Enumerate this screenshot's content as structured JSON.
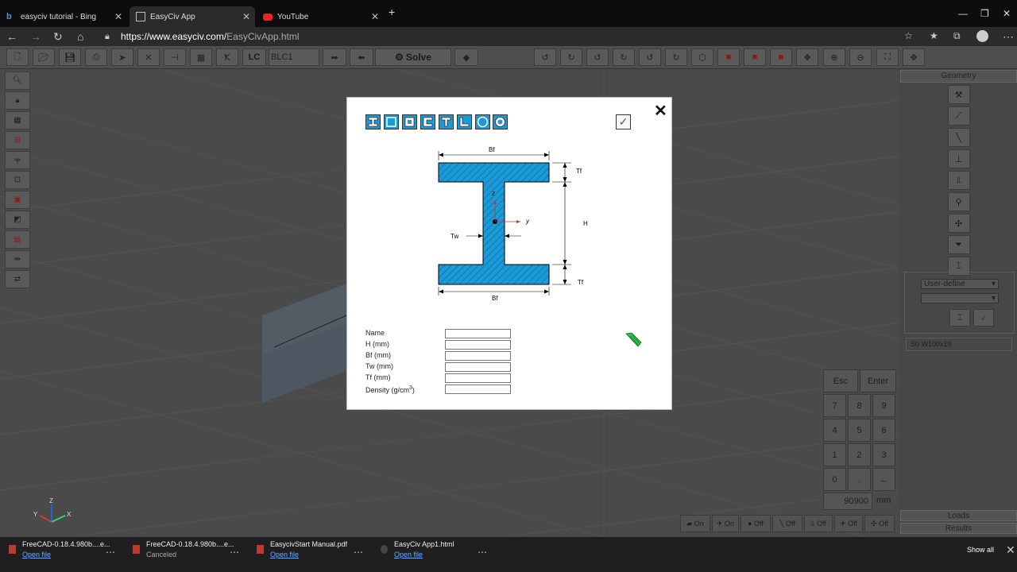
{
  "browser": {
    "tabs": [
      {
        "title": "easyciv tutorial - Bing",
        "active": false
      },
      {
        "title": "EasyCiv App",
        "active": true
      },
      {
        "title": "YouTube",
        "active": false
      }
    ],
    "new_tab": "+",
    "url_main": "https://www.easyciv.com/",
    "url_path": "EasyCivApp.html"
  },
  "toolbar": {
    "lc_label": "LC",
    "load_case": "BLC1",
    "solve_label": "Solve"
  },
  "right_panel": {
    "geometry_tab": "Geometry",
    "select_value": "User-define",
    "section_info": "S0  W100x19",
    "loads_tab": "Loads",
    "results_tab": "Results"
  },
  "numpad": {
    "esc": "Esc",
    "enter": "Enter",
    "keys": [
      "7",
      "8",
      "9",
      "4",
      "5",
      "6",
      "1",
      "2",
      "3",
      "0",
      ".",
      "←"
    ],
    "value": "90900",
    "unit": "mm"
  },
  "bottom_toggles": [
    "On",
    "On",
    "Off",
    "Off",
    "Off",
    "Off",
    "Off"
  ],
  "modal": {
    "close": "✕",
    "diagram": {
      "bf_top": "Bf",
      "bf_bottom": "Bf",
      "tf_top": "Tf",
      "tf_bottom": "Tf",
      "h": "H",
      "tw": "Tw",
      "axis_y": "y",
      "axis_z": "z"
    },
    "fields": [
      {
        "label": "Name",
        "value": ""
      },
      {
        "label": "H (mm)",
        "value": ""
      },
      {
        "label": "Bf (mm)",
        "value": ""
      },
      {
        "label": "Tw (mm)",
        "value": ""
      },
      {
        "label": "Tf (mm)",
        "value": ""
      }
    ],
    "density_label": "Density (g/cm",
    "density_sup": "3",
    "density_close": ")"
  },
  "downloads": [
    {
      "name": "FreeCAD-0.18.4.980b....e...",
      "status": "Open file"
    },
    {
      "name": "FreeCAD-0.18.4.980b....e...",
      "status": "Canceled"
    },
    {
      "name": "EasycivStart Manual.pdf",
      "status": "Open file"
    },
    {
      "name": "EasyCiv App1.html",
      "status": "Open file"
    }
  ],
  "show_all": "Show all"
}
